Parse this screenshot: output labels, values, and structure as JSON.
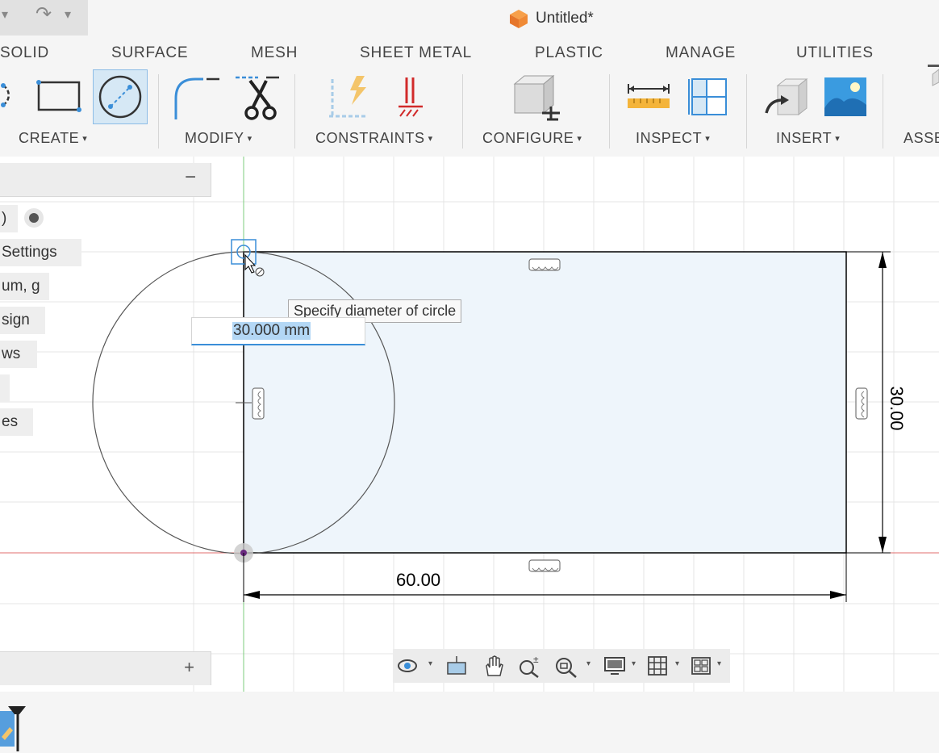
{
  "window": {
    "title": "Untitled*",
    "undo_glyph": "↶",
    "redo_glyph": "↷",
    "dropdown_glyph": "▾"
  },
  "tabs": [
    "SOLID",
    "SURFACE",
    "MESH",
    "SHEET METAL",
    "PLASTIC",
    "MANAGE",
    "UTILITIES"
  ],
  "toolbar": {
    "groups": {
      "create": "CREATE",
      "modify": "MODIFY",
      "constraints": "CONSTRAINTS",
      "configure": "CONFIGURE",
      "inspect": "INSPECT",
      "insert": "INSERT",
      "assemble": "ASSE"
    },
    "caret": "▾",
    "active_tool": "diameter-circle-icon",
    "icons": [
      "arc-icon",
      "rectangle-icon",
      "diameter-circle-icon",
      "fillet-icon",
      "trim-icon",
      "constraints-icon",
      "fix-constraint-icon",
      "configure-icon",
      "measure-icon",
      "section-analysis-icon",
      "insert-derive-icon",
      "insert-image-icon"
    ]
  },
  "panel": {
    "collapse": "−",
    "expand": "+",
    "items": [
      "Settings",
      "um, g",
      "sign",
      "ws",
      "",
      "es"
    ],
    "partial_item": ")"
  },
  "sketch": {
    "tooltip": "Specify diameter of circle",
    "diameter_input": "30.000 mm",
    "dimension_width": "60.00",
    "dimension_height": "30.00",
    "colors": {
      "profile_fill": "#eef5fb",
      "line": "#000000",
      "circle": "#555555",
      "grid": "#e4e4e4",
      "x_axis": "#e06d6d",
      "y_axis": "#7ccd7c",
      "accent": "#3a8ed8"
    }
  },
  "navbar": {
    "icons": [
      "orbit-icon",
      "look-at-icon",
      "pan-icon",
      "zoom-icon",
      "fit-icon",
      "display-settings-icon",
      "grid-settings-icon",
      "viewports-icon"
    ],
    "caret": "▾"
  }
}
